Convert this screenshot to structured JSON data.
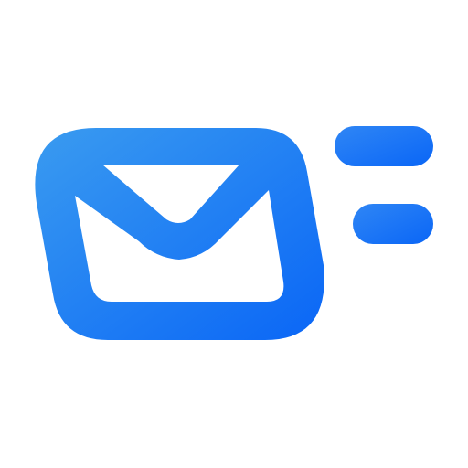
{
  "icon": {
    "name": "send-mail-icon",
    "parts": [
      "envelope-icon",
      "speed-lines-icon"
    ]
  },
  "colors": {
    "background": "#ffffff",
    "gradient_start": "#3a9bf0",
    "gradient_end": "#0a66f6"
  }
}
